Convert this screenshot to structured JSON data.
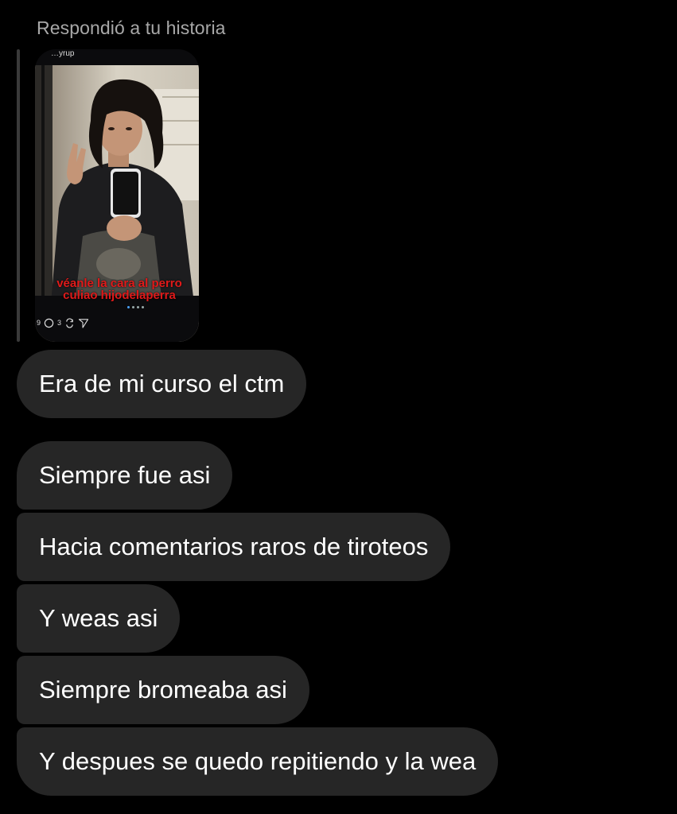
{
  "reply_label": "Respondió a tu historia",
  "story": {
    "username": "…yrup",
    "caption_line1": "véanle la cara al perro",
    "caption_line2": "culiao hijodelaperra",
    "likes_count": "9",
    "comments_count": "3",
    "page_count": 4,
    "active_page": 1
  },
  "messages": [
    {
      "text": "Era de mi curso el ctm"
    },
    {
      "text": "Siempre fue asi"
    },
    {
      "text": "Hacia comentarios raros de tiroteos"
    },
    {
      "text": "Y weas asi"
    },
    {
      "text": "Siempre bromeaba asi"
    },
    {
      "text": "Y despues se quedo repitiendo y la wea"
    }
  ],
  "colors": {
    "background": "#000000",
    "bubble": "#262626",
    "caption_red": "#e01a1a",
    "label_gray": "#a8a8a8"
  }
}
